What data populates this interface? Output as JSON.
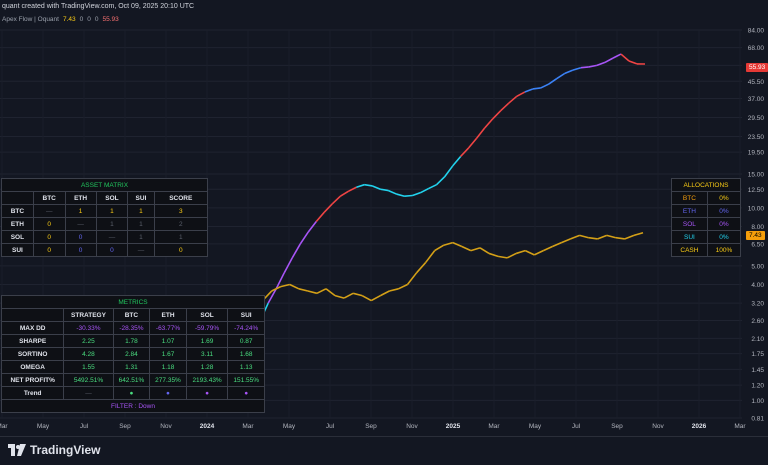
{
  "header": {
    "created": "quant created with TradingView.com, Oct 09, 2025 20:10 UTC",
    "indicator_name": "Apex Flow | Oquant",
    "indicator_value": "7.43",
    "indicator_vals": [
      "0",
      "0",
      "0"
    ],
    "indicator_last": "55.93"
  },
  "price_tags": {
    "upper": "55.93",
    "lower": "7.43"
  },
  "brand": "TradingView",
  "asset_matrix": {
    "title": "ASSET MATRIX",
    "columns": [
      "",
      "BTC",
      "ETH",
      "SOL",
      "SUI",
      "SCORE"
    ],
    "rows": [
      {
        "label": "BTC",
        "cells": [
          "—",
          "1",
          "1",
          "1",
          "3"
        ]
      },
      {
        "label": "ETH",
        "cells": [
          "0",
          "—",
          "1",
          "1",
          "2"
        ]
      },
      {
        "label": "SOL",
        "cells": [
          "0",
          "0",
          "—",
          "1",
          "1"
        ]
      },
      {
        "label": "SUI",
        "cells": [
          "0",
          "0",
          "0",
          "—",
          "0"
        ]
      }
    ]
  },
  "metrics": {
    "title": "METRICS",
    "columns": [
      "",
      "STRATEGY",
      "BTC",
      "ETH",
      "SOL",
      "SUI"
    ],
    "rows": [
      {
        "label": "MAX DD",
        "cells": [
          "-30.33%",
          "-28.35%",
          "-63.77%",
          "-59.79%",
          "-74.24%"
        ]
      },
      {
        "label": "SHARPE",
        "cells": [
          "2.25",
          "1.78",
          "1.07",
          "1.69",
          "0.87"
        ]
      },
      {
        "label": "SORTINO",
        "cells": [
          "4.28",
          "2.84",
          "1.67",
          "3.11",
          "1.68"
        ]
      },
      {
        "label": "OMEGA",
        "cells": [
          "1.55",
          "1.31",
          "1.18",
          "1.28",
          "1.13"
        ]
      },
      {
        "label": "NET PROFIT%",
        "cells": [
          "5492.51%",
          "642.51%",
          "277.35%",
          "2193.43%",
          "151.55%"
        ]
      },
      {
        "label": "Trend",
        "cells": [
          "—",
          "●",
          "●",
          "●",
          "●"
        ]
      }
    ],
    "filter": "FILTER : Down"
  },
  "allocations": {
    "title": "ALLOCATIONS",
    "rows": [
      {
        "asset": "BTC",
        "pct": "0%",
        "color": "#f59e0b"
      },
      {
        "asset": "ETH",
        "pct": "0%",
        "color": "#6366f1"
      },
      {
        "asset": "SOL",
        "pct": "0%",
        "color": "#a855f7"
      },
      {
        "asset": "SUI",
        "pct": "0%",
        "color": "#22d3ee"
      },
      {
        "asset": "CASH",
        "pct": "100%",
        "color": "#facc15"
      }
    ]
  },
  "chart_data": {
    "type": "line",
    "scale": "log",
    "ylim": [
      0.81,
      84.0
    ],
    "y_ticks": [
      "84.00",
      "68.00",
      "55.00",
      "45.50",
      "37.00",
      "29.50",
      "23.50",
      "19.50",
      "15.00",
      "12.50",
      "10.00",
      "8.00",
      "6.50",
      "5.00",
      "4.00",
      "3.20",
      "2.60",
      "2.10",
      "1.75",
      "1.45",
      "1.20",
      "1.00",
      "0.81"
    ],
    "x_ticks": [
      "Mar",
      "May",
      "Jul",
      "Sep",
      "Nov",
      "2024",
      "Mar",
      "May",
      "Jul",
      "Sep",
      "Nov",
      "2025",
      "Mar",
      "May",
      "Jul",
      "Sep",
      "Nov",
      "2026",
      "Mar"
    ],
    "series": [
      {
        "values": [
          1.0,
          1.02,
          1.05,
          1.08,
          1.1,
          1.15,
          1.2,
          1.3,
          1.45,
          1.7,
          2.1,
          2.6,
          3.2,
          3.8,
          4.6,
          5.5,
          6.5,
          7.5,
          8.5,
          9.5,
          10.5,
          11.5,
          12.2,
          12.8,
          13.2,
          13.0,
          12.5,
          12.3,
          11.8,
          11.5,
          11.6,
          12.0,
          12.6,
          13.2,
          14.5,
          16.5,
          18.5,
          20.5,
          23.0,
          26.0,
          29.0,
          32.0,
          35.0,
          38.0,
          40.0,
          41.5,
          42.0,
          44.0,
          47.0,
          50.0,
          52.0,
          53.5,
          54.0,
          55.0,
          57.0,
          60.0,
          63.0,
          58.0,
          56.0,
          55.93
        ]
      },
      {
        "values": [
          1.0,
          1.05,
          1.1,
          1.2,
          1.35,
          1.55,
          1.8,
          2.1,
          2.5,
          2.9,
          3.3,
          3.7,
          3.9,
          4.0,
          3.8,
          3.7,
          3.6,
          3.8,
          3.5,
          3.4,
          3.6,
          3.5,
          3.3,
          3.5,
          3.7,
          3.8,
          4.0,
          4.6,
          5.2,
          6.0,
          6.4,
          6.6,
          6.3,
          6.0,
          6.2,
          5.8,
          5.6,
          5.5,
          5.8,
          6.0,
          5.7,
          6.0,
          6.3,
          6.6,
          6.9,
          7.2,
          7.0,
          6.9,
          7.2,
          7.0,
          6.9,
          7.2,
          7.43
        ]
      }
    ]
  }
}
